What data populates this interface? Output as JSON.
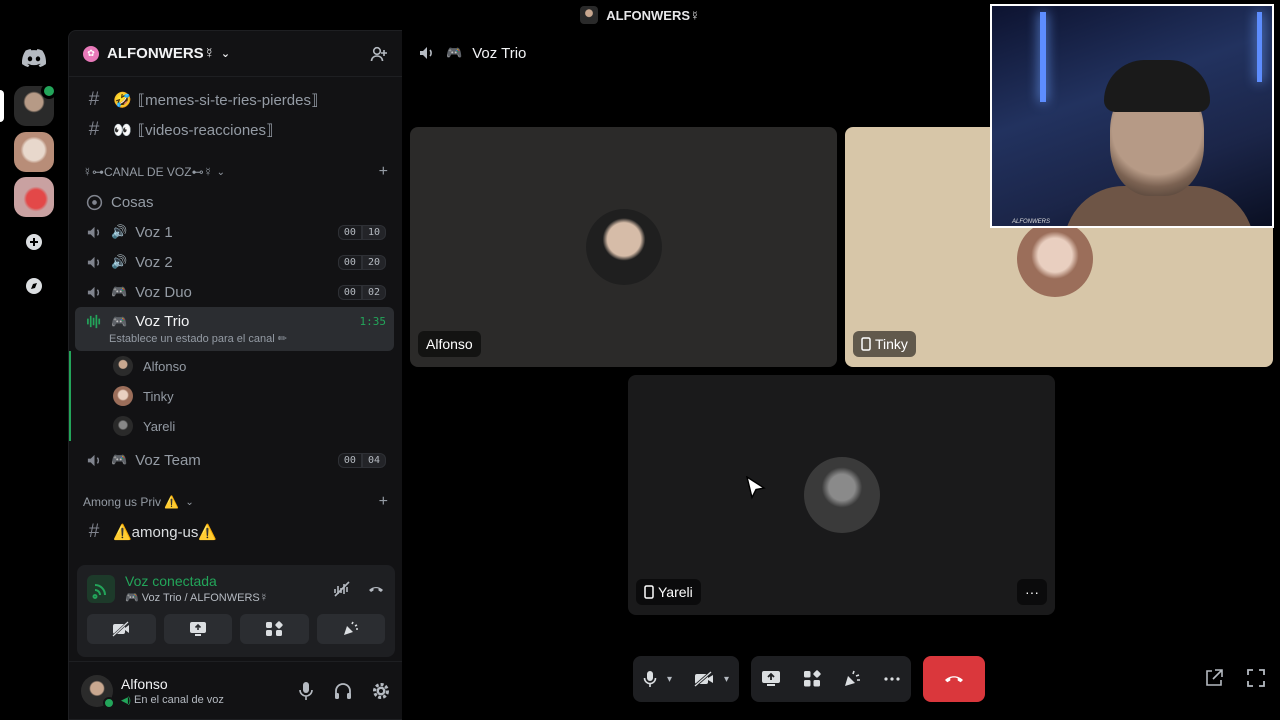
{
  "window": {
    "title": "ALFONWERS☿"
  },
  "server": {
    "name": "ALFONWERS☿"
  },
  "channels": {
    "text_top": [
      {
        "emoji": "🤣",
        "name": "⟦memes-si-te-ries-pierdes⟧"
      },
      {
        "emoji": "👀",
        "name": "⟦videos-reacciones⟧"
      }
    ],
    "category_voice": "☿⊶CANAL DE VOZ⊷☿",
    "stage": {
      "name": "Cosas"
    },
    "voice": [
      {
        "emoji": "🔊",
        "name": "Voz 1",
        "count": "00",
        "limit": "10"
      },
      {
        "emoji": "🔊",
        "name": "Voz 2",
        "count": "00",
        "limit": "20"
      },
      {
        "emoji": "🎮",
        "name": "Voz Duo",
        "count": "00",
        "limit": "02"
      }
    ],
    "active": {
      "emoji": "🎮",
      "name": "Voz Trio",
      "timer": "1:35",
      "status": "Establece un estado para el canal ✏"
    },
    "voice_users": [
      "Alfonso",
      "Tinky",
      "Yareli"
    ],
    "voice_after": {
      "emoji": "🎮",
      "name": "Voz Team",
      "count": "00",
      "limit": "04"
    },
    "category_among": "Among us Priv ⚠️",
    "among_channel": "⚠️among-us⚠️"
  },
  "voice_panel": {
    "title": "Voz conectada",
    "subtitle": "🎮 Voz Trio / ALFONWERS☿"
  },
  "user": {
    "name": "Alfonso",
    "status": "En el canal de voz"
  },
  "main": {
    "channel_title": "Voz Trio",
    "channel_emoji": "🎮",
    "tiles": [
      {
        "name": "Alfonso"
      },
      {
        "name": "Tinky"
      },
      {
        "name": "Yareli"
      }
    ],
    "more_label": "···"
  },
  "webcam": {
    "caption": "ALFONWERS"
  },
  "colors": {
    "green": "#23a55a",
    "hangup": "#da373c",
    "tinky_bg": "#d7c6a8"
  }
}
